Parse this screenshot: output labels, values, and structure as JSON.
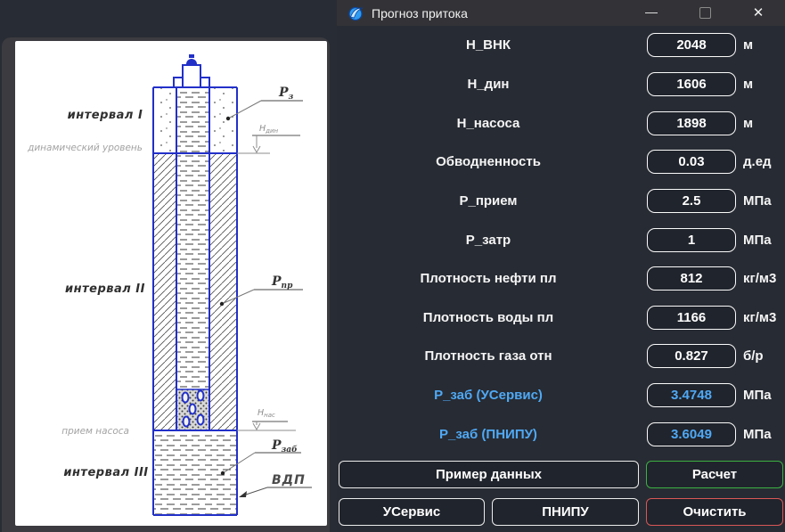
{
  "colors": {
    "accent_blue": "#4fa9f5",
    "button_green": "#3cb043",
    "button_red": "#d95757",
    "well_blue": "#2230c8"
  },
  "window": {
    "title": "Прогноз притока",
    "controls": {
      "minimize": "—",
      "close": "✕"
    }
  },
  "form": {
    "rows": [
      {
        "label": "Н_ВНК",
        "value": "2048",
        "unit": "м"
      },
      {
        "label": "Н_дин",
        "value": "1606",
        "unit": "м"
      },
      {
        "label": "Н_насоса",
        "value": "1898",
        "unit": "м"
      },
      {
        "label": "Обводненность",
        "value": "0.03",
        "unit": "д.ед"
      },
      {
        "label": "Р_прием",
        "value": "2.5",
        "unit": "МПа"
      },
      {
        "label": "Р_затр",
        "value": "1",
        "unit": "МПа"
      },
      {
        "label": "Плотность нефти пл",
        "value": "812",
        "unit": "кг/м3"
      },
      {
        "label": "Плотность воды пл",
        "value": "1166",
        "unit": "кг/м3"
      },
      {
        "label": "Плотность газа отн",
        "value": "0.827",
        "unit": "б/р"
      },
      {
        "label": "Р_заб (УСервис)",
        "value": "3.4748",
        "unit": "МПа"
      },
      {
        "label": "Р_заб (ПНИПУ)",
        "value": "3.6049",
        "unit": "МПа"
      }
    ]
  },
  "buttons": {
    "example": "Пример данных",
    "calc": "Расчет",
    "uservice": "УСервис",
    "pnipu": "ПНИПУ",
    "clear": "Очистить"
  },
  "diagram": {
    "interval1": "интервал I",
    "dyn_level": "динамический уровень",
    "interval2": "интервал II",
    "pump_intake": "прием насоса",
    "interval3": "интервал III",
    "p_annulus": {
      "main": "Р",
      "sub": "з"
    },
    "h_dyn": {
      "main": "Н",
      "sub": "дин"
    },
    "p_intake": {
      "main": "Р",
      "sub": "пр"
    },
    "h_pump": {
      "main": "Н",
      "sub": "нас"
    },
    "p_bottomhole": {
      "main": "Р",
      "sub": "заб"
    },
    "vdp": "ВДП"
  }
}
